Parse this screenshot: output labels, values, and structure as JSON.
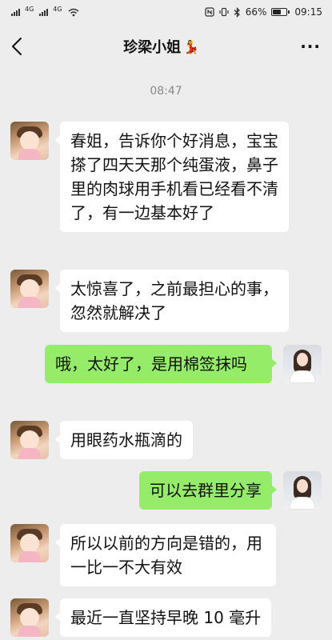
{
  "status_bar": {
    "network_1": "4G",
    "network_2": "4G",
    "battery_text": "66%",
    "battery_level": 0.66,
    "time": "09:15",
    "icons": [
      "sim-signal-icon",
      "sim-signal-icon",
      "wifi-icon",
      "nfc-icon",
      "vibrate-icon",
      "bluetooth-icon",
      "battery-icon"
    ]
  },
  "header": {
    "title": "珍梁小姐",
    "title_emoji": "💃",
    "back_icon": "chevron-left-icon",
    "more_icon": "more-dots-icon",
    "more_label": "···"
  },
  "timestamp": "08:47",
  "colors": {
    "background": "#ededed",
    "incoming_bubble": "#ffffff",
    "outgoing_bubble": "#95ec69"
  },
  "messages": [
    {
      "side": "left",
      "sender": "contact",
      "text": "春姐，告诉你个好消息，宝宝搽了四天天那个纯蛋液，鼻子里的肉球用手机看已经看不清了，有一边基本好了"
    },
    {
      "side": "left",
      "sender": "contact",
      "text": "太惊喜了，之前最担心的事，忽然就解决了"
    },
    {
      "side": "right",
      "sender": "me",
      "text": "哦，太好了，是用棉签抹吗"
    },
    {
      "side": "left",
      "sender": "contact",
      "text": "用眼药水瓶滴的"
    },
    {
      "side": "right",
      "sender": "me",
      "text": "可以去群里分享"
    },
    {
      "side": "left",
      "sender": "contact",
      "text": "所以以前的方向是错的，用一比一不大有效"
    },
    {
      "side": "left",
      "sender": "contact",
      "text": "最近一直坚持早晚 10 毫升"
    }
  ]
}
